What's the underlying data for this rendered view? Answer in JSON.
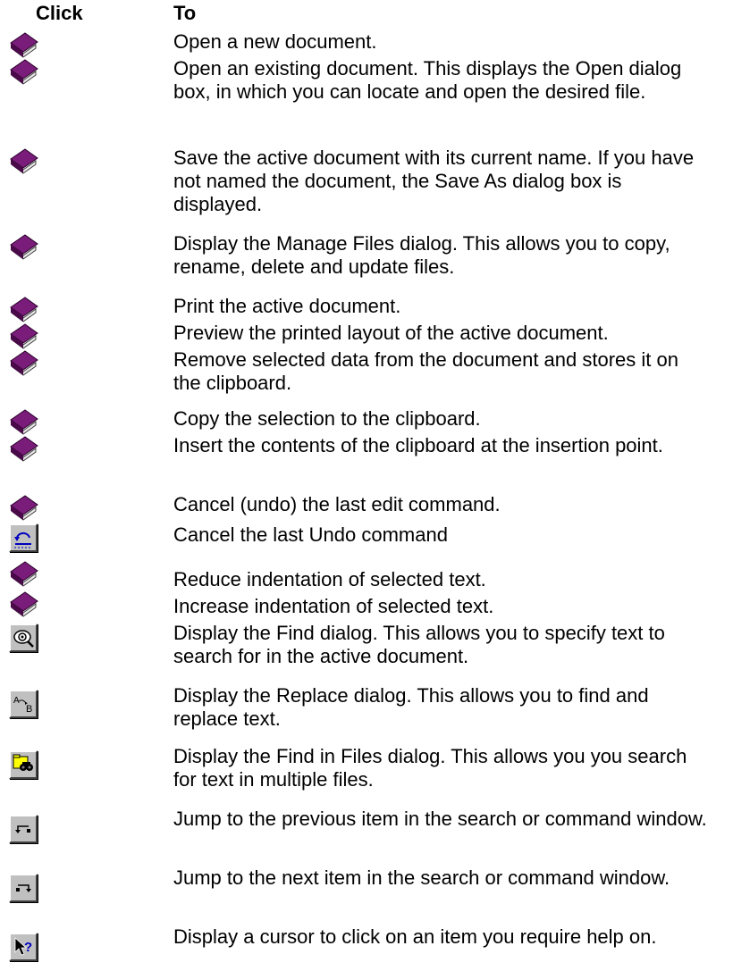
{
  "header": {
    "click": "Click",
    "to": "To"
  },
  "rows": [
    {
      "icon": "book-icon",
      "text": "Open a new document."
    },
    {
      "icon": "book-icon",
      "text": "Open an existing document.   This displays the Open dialog box, in which you can locate and open the desired file."
    },
    {
      "icon": "book-icon",
      "text": "Save the active document with its current name.   If you have not named the document, the Save As dialog box is displayed."
    },
    {
      "icon": "book-icon",
      "text": "Display the Manage Files dialog.   This allows you to copy, rename, delete and update files."
    },
    {
      "icon": "book-icon",
      "text": "Print the active document."
    },
    {
      "icon": "book-icon",
      "text": "Preview the printed layout of the active document."
    },
    {
      "icon": "book-icon",
      "text": "Remove selected data from the document and stores it on the clipboard."
    },
    {
      "icon": "book-icon",
      "text": "Copy the selection to the clipboard."
    },
    {
      "icon": "book-icon",
      "text": "Insert the contents of the clipboard at the insertion point."
    },
    {
      "icon": "book-icon",
      "text": "Cancel (undo) the last edit command."
    },
    {
      "icon": "redo-icon",
      "text": "Cancel the last Undo command"
    },
    {
      "icon": "book-icon",
      "text": "Reduce indentation of selected text."
    },
    {
      "icon": "book-icon",
      "text": "Increase indentation of selected text."
    },
    {
      "icon": "find-icon",
      "text": "Display the Find dialog.   This allows you to specify text to search for in the active document."
    },
    {
      "icon": "replace-icon",
      "text": "Display the Replace dialog.   This allows you to find and replace text."
    },
    {
      "icon": "find-in-files-icon",
      "text": "Display the Find in Files dialog.   This allows you you search for text in multiple files."
    },
    {
      "icon": "previous-item-icon",
      "text": "Jump to the previous item in the search or command window."
    },
    {
      "icon": "next-item-icon",
      "text": "Jump to the next item in the search or command window."
    },
    {
      "icon": "context-help-icon",
      "text": "Display a cursor to click on an item you require help on."
    }
  ]
}
